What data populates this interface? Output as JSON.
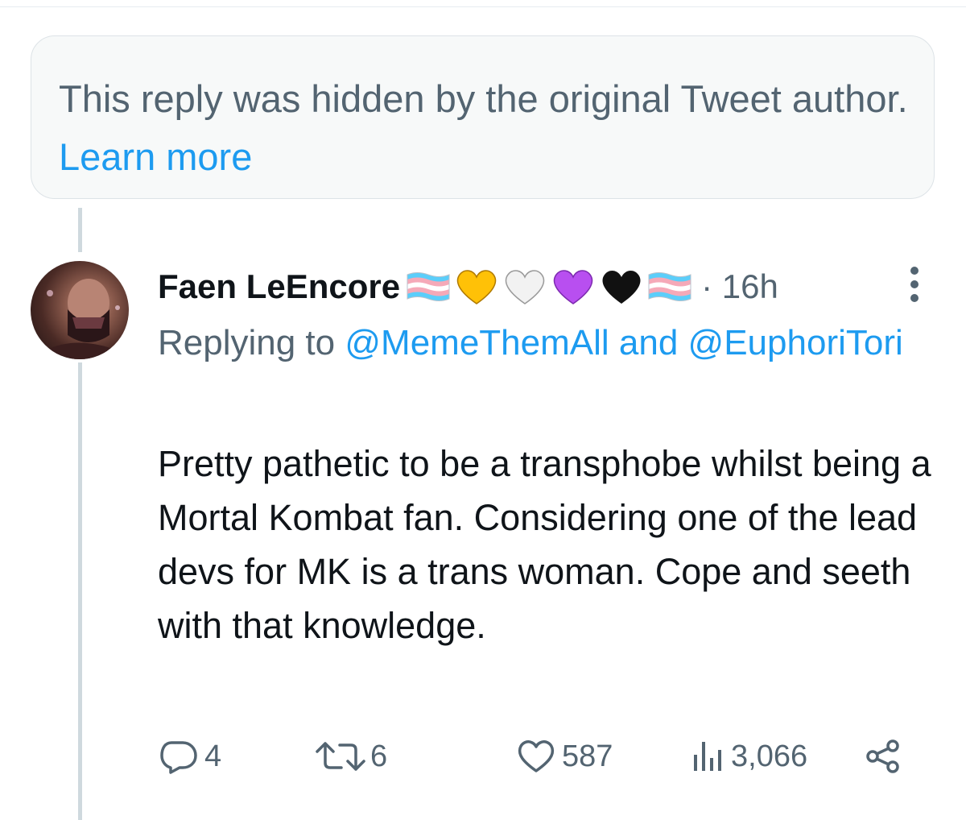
{
  "hidden_notice": {
    "text": "This reply was hidden by the original Tweet author.",
    "link": "Learn more"
  },
  "tweet": {
    "display_name": "Faen LeEncore",
    "name_emojis": [
      "trans-flag",
      "yellow-heart",
      "white-heart",
      "purple-heart",
      "black-heart",
      "trans-flag"
    ],
    "separator": "·",
    "time": "16h",
    "replying_prefix": "Replying to",
    "mention_1": "@MemeThemAll",
    "and_word": "and",
    "mention_2": "@EuphoriTori",
    "text": "Pretty pathetic to be a transphobe whilst being a Mortal Kombat fan. Considering one of the lead devs for MK is a trans woman. Cope and seeth with that knowledge.",
    "actions": {
      "replies": "4",
      "retweets": "6",
      "likes": "587",
      "views": "3,066"
    }
  },
  "icons": {
    "reply": "reply-icon",
    "retweet": "retweet-icon",
    "like": "heart-icon",
    "views": "views-icon",
    "share": "share-icon",
    "more": "more-icon"
  },
  "colors": {
    "link": "#1d9bf0",
    "secondary_text": "#536471",
    "primary_text": "#0f1419",
    "notice_bg": "#f7f9f9",
    "trans_blue": "#5bcefa",
    "trans_pink": "#f5a9b8",
    "yellow_heart": "#ffc107",
    "purple_heart": "#b84ff0"
  }
}
